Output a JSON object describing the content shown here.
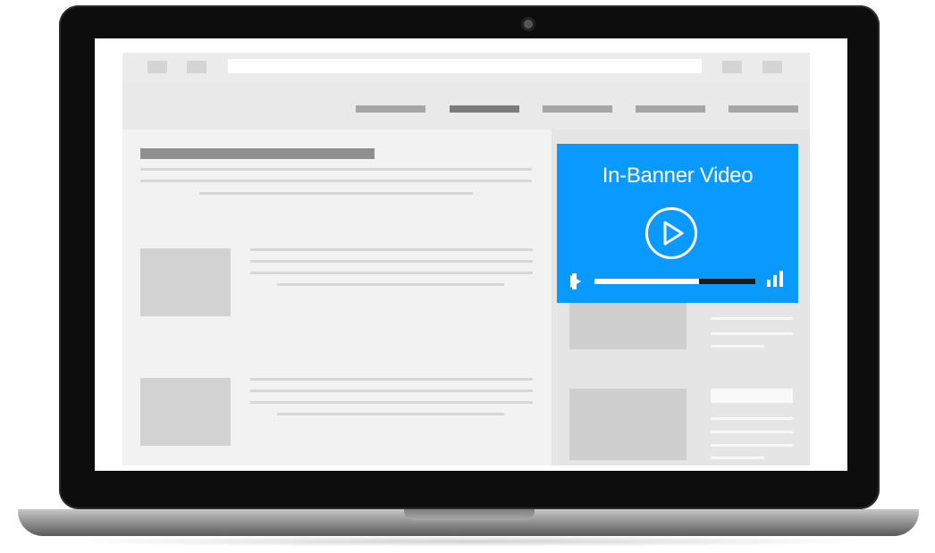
{
  "ad": {
    "title": "In-Banner Video",
    "progress_fraction": 0.65
  },
  "icons": {
    "big_play": "play-circle-icon",
    "small_play": "play-icon",
    "volume": "signal-bars-icon"
  },
  "colors": {
    "ad_background": "#0a99ff",
    "progress_track": "#1a1a1a",
    "progress_fill": "#ffffff"
  }
}
